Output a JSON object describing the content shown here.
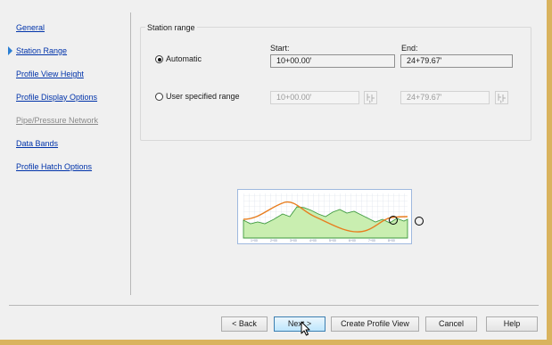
{
  "nav": {
    "items": [
      {
        "label": "General",
        "state": "normal"
      },
      {
        "label": "Station Range",
        "state": "selected"
      },
      {
        "label": "Profile View Height",
        "state": "normal"
      },
      {
        "label": "Profile Display Options",
        "state": "normal"
      },
      {
        "label": "Pipe/Pressure Network",
        "state": "disabled"
      },
      {
        "label": "Data Bands",
        "state": "normal"
      },
      {
        "label": "Profile Hatch Options",
        "state": "normal"
      }
    ]
  },
  "station_range": {
    "title": "Station range",
    "automatic": {
      "label": "Automatic",
      "selected": true,
      "start_label": "Start:",
      "end_label": "End:",
      "start_value": "10+00.00'",
      "end_value": "24+79.67'"
    },
    "user_specified": {
      "label": "User specified range",
      "selected": false,
      "start_value": "10+00.00'",
      "end_value": "24+79.67'"
    }
  },
  "preview": {
    "x_tick_labels": [
      "1+00",
      "2+00",
      "3+00",
      "4+00",
      "5+00",
      "6+00",
      "7+00",
      "8+00"
    ]
  },
  "colors": {
    "link": "#0033aa",
    "selection_arrow": "#2a7fd4",
    "profile_line": "#e87d1e",
    "surface_fill": "#c9eeb0",
    "surface_line": "#3e9a3e",
    "window_border": "#d9b35e"
  },
  "buttons": {
    "back": "< Back",
    "next": "Next >",
    "create": "Create Profile View",
    "cancel": "Cancel",
    "help": "Help"
  }
}
